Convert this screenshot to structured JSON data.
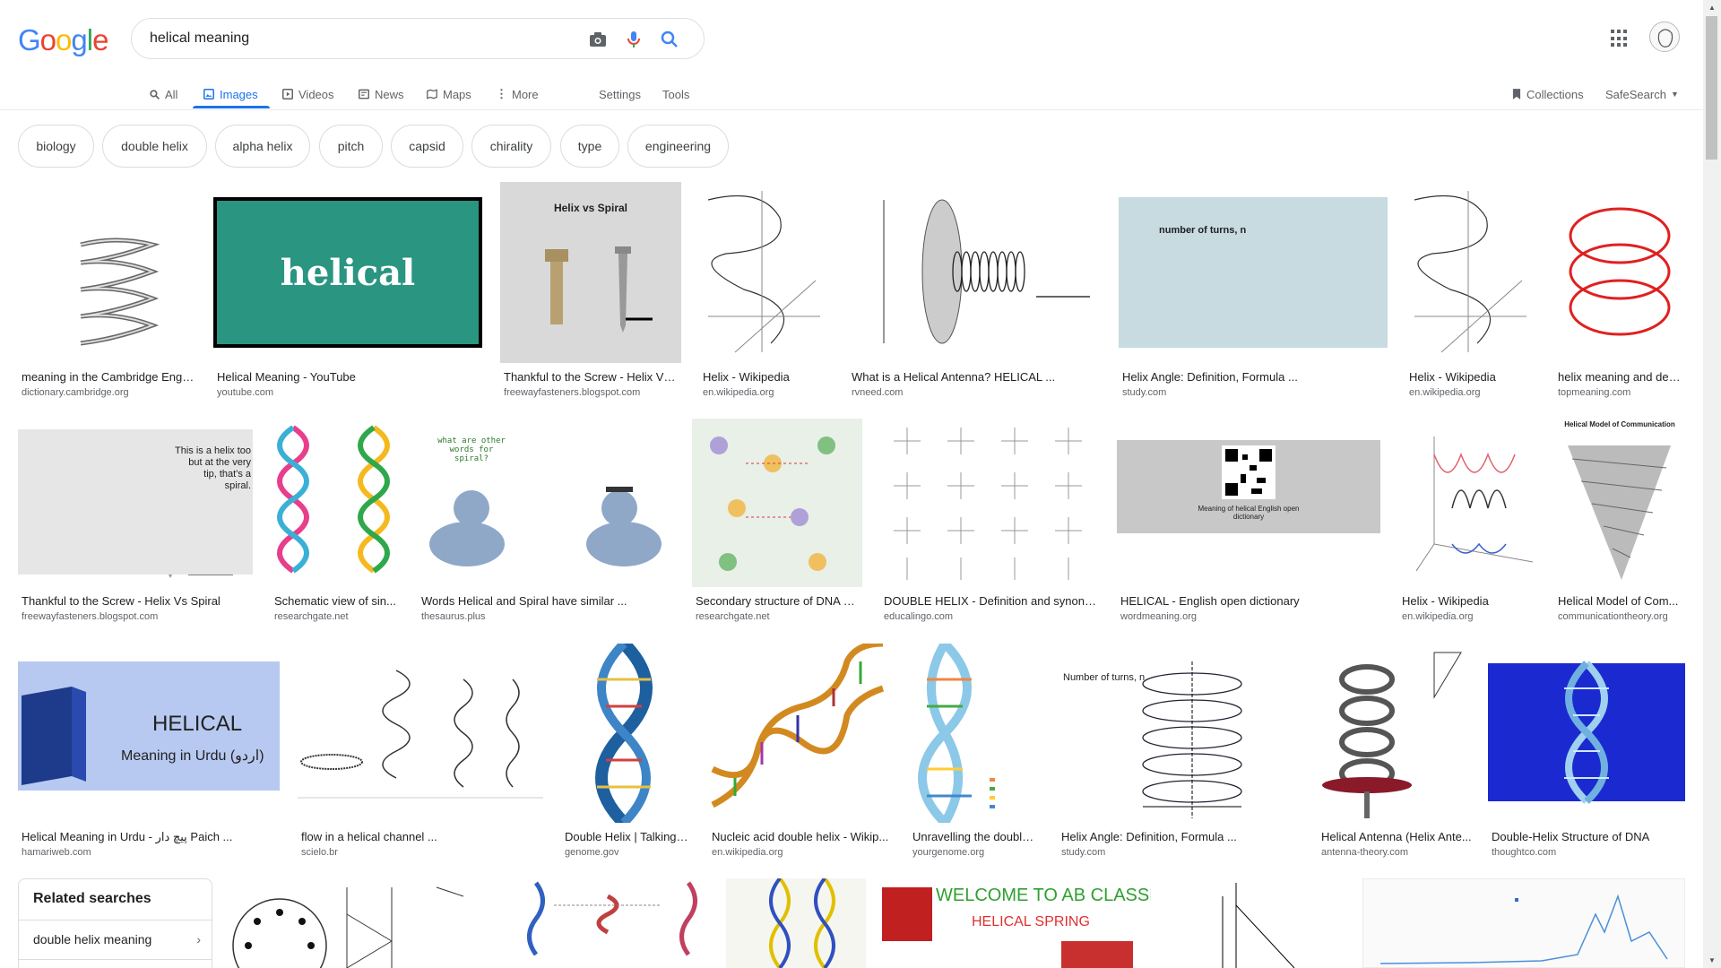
{
  "header": {
    "logo_letters": [
      "G",
      "o",
      "o",
      "g",
      "l",
      "e"
    ],
    "logo_colors": [
      "#4285f4",
      "#ea4335",
      "#fbbc05",
      "#4285f4",
      "#34a853",
      "#ea4335"
    ],
    "search_value": "helical meaning"
  },
  "nav": {
    "tabs": [
      {
        "label": "All",
        "icon": "search-icon",
        "active": false
      },
      {
        "label": "Images",
        "icon": "image-icon",
        "active": true
      },
      {
        "label": "Videos",
        "icon": "video-icon",
        "active": false
      },
      {
        "label": "News",
        "icon": "news-icon",
        "active": false
      },
      {
        "label": "Maps",
        "icon": "map-icon",
        "active": false
      },
      {
        "label": "More",
        "icon": "more-vert-icon",
        "active": false
      }
    ],
    "settings": "Settings",
    "tools": "Tools",
    "collections": "Collections",
    "safesearch": "SafeSearch"
  },
  "chips": [
    "biology",
    "double helix",
    "alpha helix",
    "pitch",
    "capsid",
    "chirality",
    "type",
    "engineering"
  ],
  "results": [
    {
      "title": "meaning in the Cambridge Engli...",
      "source": "dictionary.cambridge.org"
    },
    {
      "title": "Helical Meaning - YouTube",
      "source": "youtube.com",
      "text": "helical"
    },
    {
      "title": "Thankful to the Screw - Helix Vs ...",
      "source": "freewayfasteners.blogspot.com",
      "text": "Helix vs Spiral"
    },
    {
      "title": "Helix - Wikipedia",
      "source": "en.wikipedia.org"
    },
    {
      "title": "What is a Helical Antenna? HELICAL ...",
      "source": "rvneed.com"
    },
    {
      "title": "Helix Angle: Definition, Formula ...",
      "source": "study.com",
      "text": "number of turns, n"
    },
    {
      "title": "Helix - Wikipedia",
      "source": "en.wikipedia.org"
    },
    {
      "title": "helix meaning and defi...",
      "source": "topmeaning.com"
    },
    {
      "title": "Thankful to the Screw - Helix Vs Spiral",
      "source": "freewayfasteners.blogspot.com",
      "text": "This is a helix too but at the very tip, that's a spiral."
    },
    {
      "title": "Schematic view of sin...",
      "source": "researchgate.net"
    },
    {
      "title": "Words Helical and Spiral have similar ...",
      "source": "thesaurus.plus",
      "text": "what are other words for spiral?"
    },
    {
      "title": "Secondary structure of DNA D...",
      "source": "researchgate.net"
    },
    {
      "title": "DOUBLE HELIX - Definition and synony...",
      "source": "educalingo.com"
    },
    {
      "title": "HELICAL - English open dictionary",
      "source": "wordmeaning.org",
      "text": "Meaning of helical English open dictionary"
    },
    {
      "title": "Helix - Wikipedia",
      "source": "en.wikipedia.org"
    },
    {
      "title": "Helical Model of Com...",
      "source": "communicationtheory.org",
      "text": "Helical Model of Communication"
    },
    {
      "title": "Helical Meaning in Urdu - پیچ دار Paich ...",
      "source": "hamariweb.com",
      "text": "HELICAL",
      "text2": "Meaning in Urdu (اردو)"
    },
    {
      "title": "flow in a helical channel ...",
      "source": "scielo.br"
    },
    {
      "title": "Double Helix | Talking ...",
      "source": "genome.gov"
    },
    {
      "title": "Nucleic acid double helix - Wikip...",
      "source": "en.wikipedia.org"
    },
    {
      "title": "Unravelling the double...",
      "source": "yourgenome.org"
    },
    {
      "title": "Helix Angle: Definition, Formula ...",
      "source": "study.com",
      "text": "Number of turns, n"
    },
    {
      "title": "Helical Antenna (Helix Ante...",
      "source": "antenna-theory.com"
    },
    {
      "title": "Double-Helix Structure of DNA",
      "source": "thoughtco.com"
    }
  ],
  "bottom_row_text": {
    "ab_classes": "WELCOME TO AB CLASSES",
    "helical_spring": "HELICAL SPRING"
  },
  "related": {
    "title": "Related searches",
    "items": [
      "double helix meaning"
    ]
  }
}
